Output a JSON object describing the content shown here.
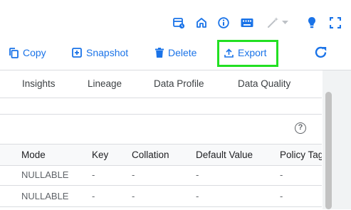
{
  "icons": [
    "schedule-calendar-icon",
    "home-icon",
    "info-icon",
    "keyboard-icon",
    "magic-wand-icon",
    "dropdown-icon",
    "lightbulb-icon",
    "fullscreen-icon"
  ],
  "colors": {
    "accent": "#1a73e8",
    "highlight": "#22e022",
    "border": "#dadce0"
  },
  "toolbar": {
    "copy_label": "Copy",
    "snapshot_label": "Snapshot",
    "delete_label": "Delete",
    "export_label": "Export"
  },
  "tabs": [
    "Insights",
    "Lineage",
    "Data Profile",
    "Data Quality"
  ],
  "table": {
    "columns": [
      "Mode",
      "Key",
      "Collation",
      "Default Value",
      "Policy Tags"
    ],
    "rows": [
      [
        "NULLABLE",
        "-",
        "-",
        "-",
        "-"
      ],
      [
        "NULLABLE",
        "-",
        "-",
        "-",
        "-"
      ]
    ]
  },
  "help_symbol": "?"
}
